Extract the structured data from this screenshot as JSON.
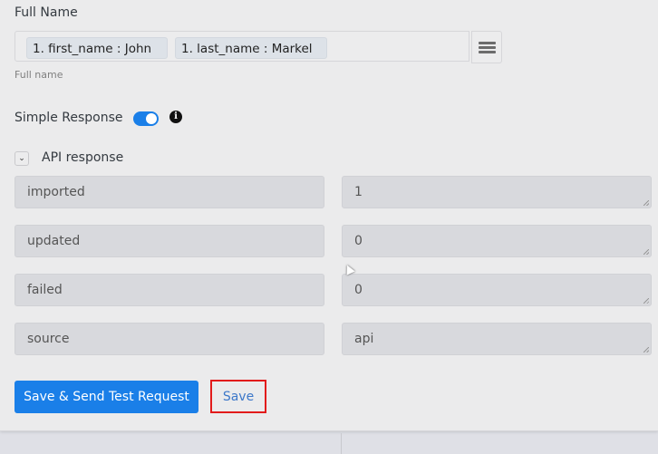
{
  "full_name_field": {
    "label": "Full Name",
    "tags": [
      "1. first_name : John",
      "1. last_name : Markel"
    ],
    "help_text": "Full name",
    "menu_icon": "hamburger-menu-icon"
  },
  "simple_response": {
    "label": "Simple Response",
    "enabled": true,
    "info_icon": "info-icon"
  },
  "api_response": {
    "title": "API response",
    "collapse_icon": "chevron-down-icon",
    "rows": [
      {
        "key": "imported",
        "value": "1"
      },
      {
        "key": "updated",
        "value": "0"
      },
      {
        "key": "failed",
        "value": "0"
      },
      {
        "key": "source",
        "value": "api"
      }
    ]
  },
  "actions": {
    "save_send_label": "Save & Send Test Request",
    "save_label": "Save"
  },
  "colors": {
    "primary": "#1a7fe8",
    "highlight_border": "#e21b1b",
    "link": "#3d78c9"
  }
}
